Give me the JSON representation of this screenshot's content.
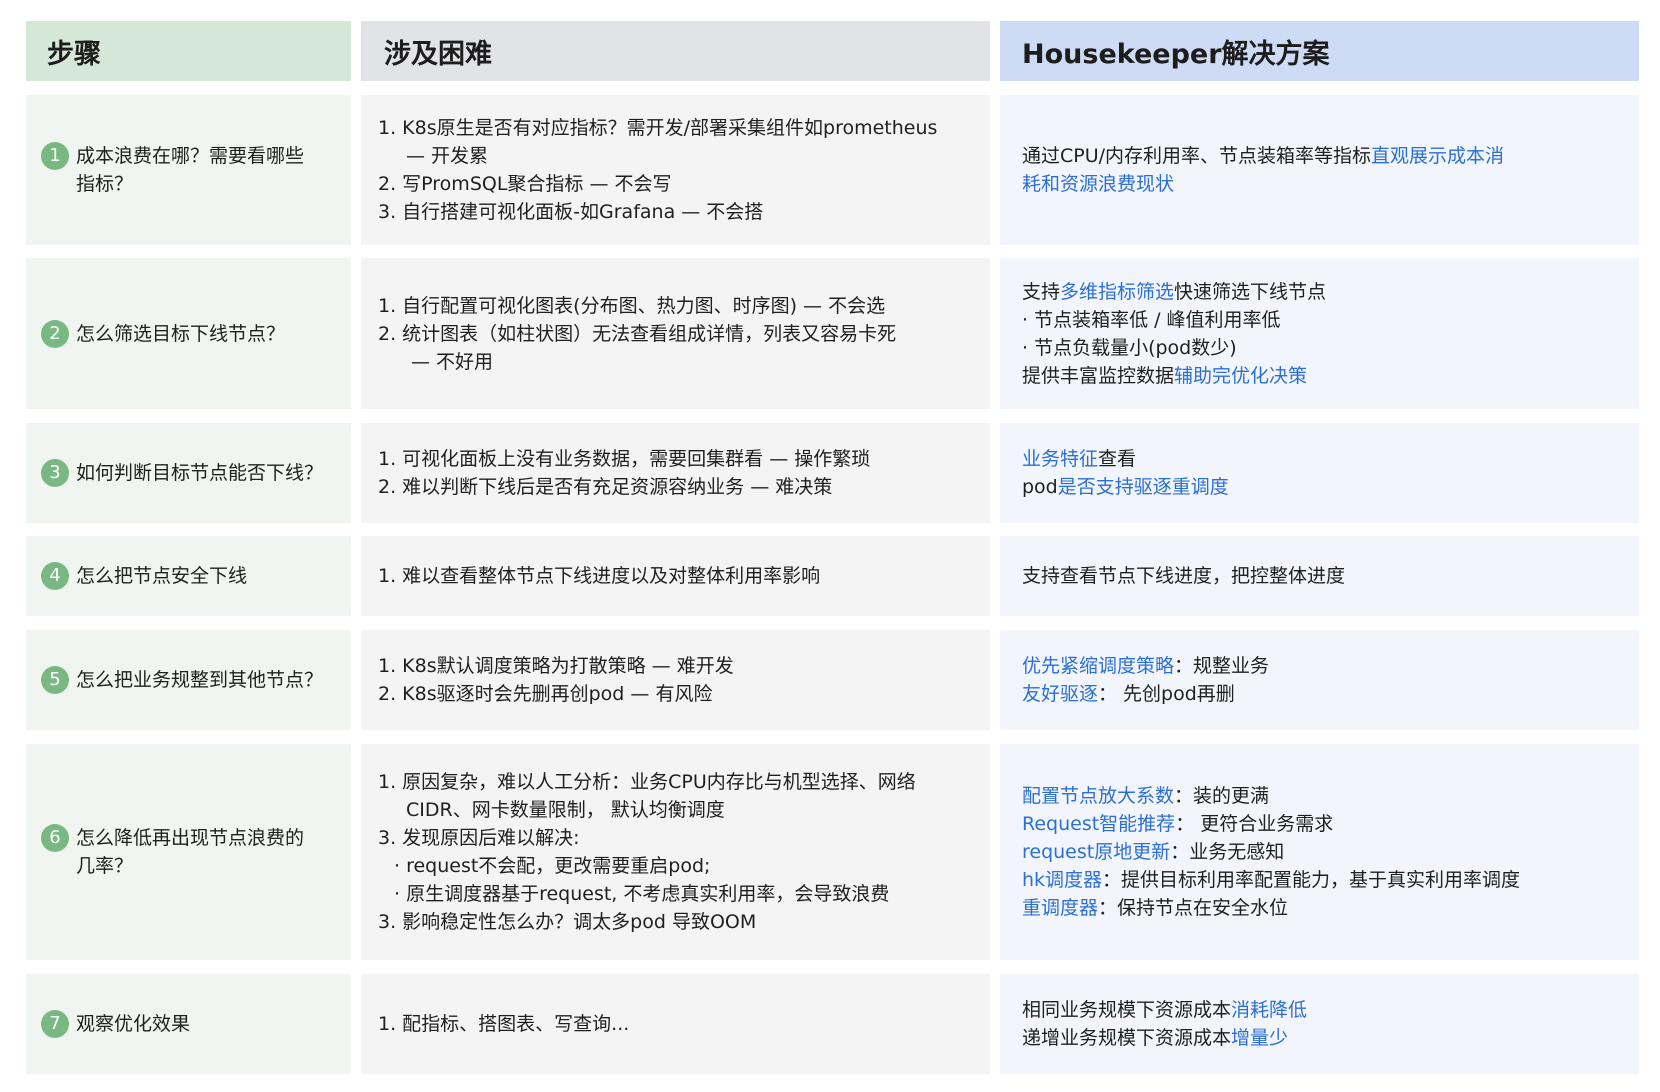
{
  "header": {
    "step": "步骤",
    "difficulty": "涉及困难",
    "solution": "Housekeeper解决方案"
  },
  "rows": [
    {
      "num": "1",
      "step_lines": [
        "成本浪费在哪？需要看哪些",
        "指标？"
      ],
      "difficulty_lines": [
        "1.  K8s原生是否有对应指标？需开发/部署采集组件如prometheus",
        "— 开发累",
        "2. 写PromSQL聚合指标 — 不会写",
        "3. 自行搭建可视化面板-如Grafana — 不会搭"
      ],
      "solution": [
        [
          {
            "t": "通过CPU/内存利用率、节点装箱率等指标"
          },
          {
            "t": "直观展示成本消",
            "hl": true
          }
        ],
        [
          {
            "t": "耗和资源浪费现状",
            "hl": true
          }
        ]
      ]
    },
    {
      "num": "2",
      "step_lines": [
        "怎么筛选目标下线节点？"
      ],
      "difficulty_lines": [
        "1.  自行配置可视化图表(分布图、热力图、时序图) — 不会选",
        "2.  统计图表（如柱状图）无法查看组成详情，列表又容易卡死",
        "— 不好用"
      ],
      "solution": [
        [
          {
            "t": "支持"
          },
          {
            "t": "多维指标筛选",
            "hl": true
          },
          {
            "t": "快速筛选下线节点"
          }
        ],
        [
          {
            "t": "· 节点装箱率低 / 峰值利用率低"
          }
        ],
        [
          {
            "t": "· 节点负载量小(pod数少)"
          }
        ],
        [
          {
            "t": "提供丰富监控数据"
          },
          {
            "t": "辅助完优化决策",
            "hl": true
          }
        ]
      ]
    },
    {
      "num": "3",
      "step_lines": [
        "如何判断目标节点能否下线？"
      ],
      "difficulty_lines": [
        "1. 可视化面板上没有业务数据，需要回集群看 — 操作繁琐",
        "2. 难以判断下线后是否有充足资源容纳业务 —  难决策"
      ],
      "solution": [
        [
          {
            "t": "业务特征",
            "hl": true
          },
          {
            "t": "查看"
          }
        ],
        [
          {
            "t": "pod"
          },
          {
            "t": "是否支持驱逐重调度",
            "hl": true
          }
        ]
      ]
    },
    {
      "num": "4",
      "step_lines": [
        "怎么把节点安全下线"
      ],
      "difficulty_lines": [
        "1. 难以查看整体节点下线进度以及对整体利用率影响"
      ],
      "solution": [
        [
          {
            "t": "支持查看节点下线进度，把控整体进度"
          }
        ]
      ]
    },
    {
      "num": "5",
      "step_lines": [
        "怎么把业务规整到其他节点？"
      ],
      "difficulty_lines": [
        "1. K8s默认调度策略为打散策略 —  难开发",
        "2. K8s驱逐时会先删再创pod —  有风险"
      ],
      "solution": [
        [
          {
            "t": "优先紧缩调度策略",
            "hl": true
          },
          {
            "t": "：规整业务"
          }
        ],
        [
          {
            "t": "友好驱逐",
            "hl": true
          },
          {
            "t": "：  先创pod再删"
          }
        ]
      ]
    },
    {
      "num": "6",
      "step_lines": [
        "怎么降低再出现节点浪费的",
        "几率？"
      ],
      "difficulty_lines": [
        "1. 原因复杂，难以人工分析：业务CPU内存比与机型选择、网络",
        "CIDR、网卡数量限制，  默认均衡调度",
        "3. 发现原因后难以解决:",
        "· request不会配，更改需要重启pod;",
        "· 原生调度器基于request, 不考虑真实利用率，会导致浪费",
        "3. 影响稳定性怎么办？调太多pod 导致OOM"
      ],
      "solution": [
        [
          {
            "t": "配置节点放大系数",
            "hl": true
          },
          {
            "t": "：装的更满"
          }
        ],
        [
          {
            "t": "Request智能推荐",
            "hl": true
          },
          {
            "t": "：  更符合业务需求"
          }
        ],
        [
          {
            "t": "request原地更新",
            "hl": true
          },
          {
            "t": "：业务无感知"
          }
        ],
        [
          {
            "t": "hk调度器",
            "hl": true
          },
          {
            "t": "：提供目标利用率配置能力，基于真实利用率调度"
          }
        ],
        [
          {
            "t": "重调度器",
            "hl": true
          },
          {
            "t": "：保持节点在安全水位"
          }
        ]
      ]
    },
    {
      "num": "7",
      "step_lines": [
        "观察优化效果"
      ],
      "difficulty_lines": [
        "1. 配指标、搭图表、写查询..."
      ],
      "solution": [
        [
          {
            "t": "相同业务规模下资源成本"
          },
          {
            "t": "消耗降低",
            "hl": true
          }
        ],
        [
          {
            "t": "递增业务规模下资源成本"
          },
          {
            "t": "增量少",
            "hl": true
          }
        ]
      ]
    }
  ],
  "colors": {
    "step_header_bg": "#d5e8d7",
    "difficulty_header_bg": "#e2e3e6",
    "solution_header_bg": "#cddcf4",
    "step_cell_bg": "#f0f5f1",
    "difficulty_cell_bg": "#f4f4f5",
    "solution_cell_bg": "#f2f6fc",
    "badge": "#79b883",
    "highlight_text": "#2c6fd4"
  }
}
